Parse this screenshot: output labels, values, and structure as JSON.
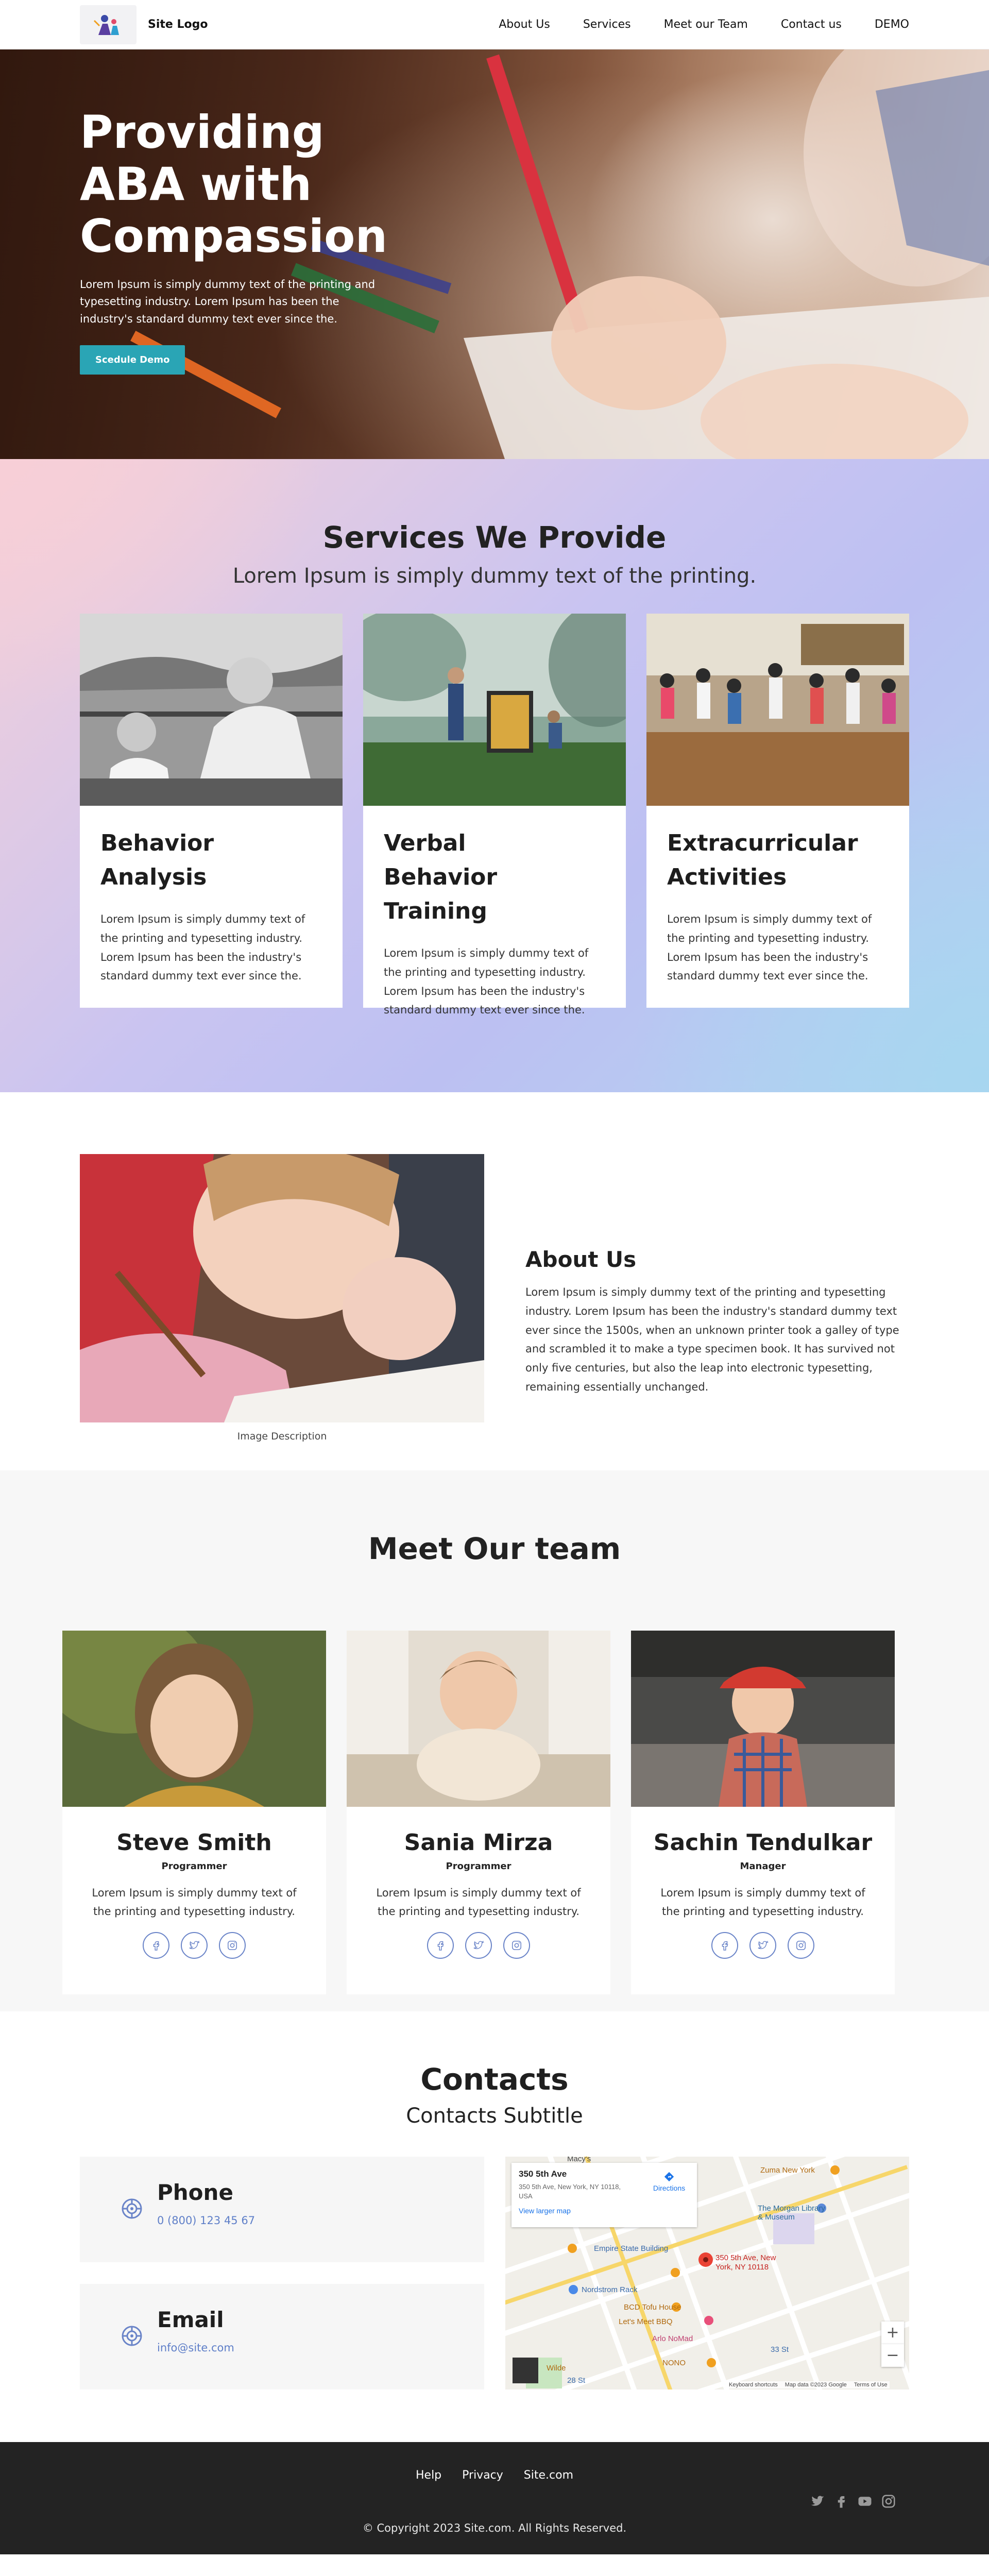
{
  "header": {
    "logo_text": "Site Logo",
    "nav": [
      "About Us",
      "Services",
      "Meet our Team",
      "Contact us",
      "DEMO"
    ]
  },
  "hero": {
    "title": "Providing ABA with Compassion",
    "text": "Lorem Ipsum is simply dummy text of the printing and typesetting industry. Lorem Ipsum has been the industry's standard dummy text ever since the.",
    "button": "Scedule Demo"
  },
  "services": {
    "title": "Services We Provide",
    "subtitle": "Lorem Ipsum is simply dummy text of the printing.",
    "cards": [
      {
        "title": "Behavior Analysis",
        "text": "Lorem Ipsum is simply dummy text of the printing and typesetting industry. Lorem Ipsum has been the industry's standard dummy text ever since the."
      },
      {
        "title": "Verbal Behavior Training",
        "text": "Lorem Ipsum is simply dummy text of the printing and typesetting industry. Lorem Ipsum has been the industry's standard dummy text ever since the."
      },
      {
        "title": "Extracurricular Activities",
        "text": "Lorem Ipsum is simply dummy text of the printing and typesetting industry. Lorem Ipsum has been the industry's standard dummy text ever since the."
      }
    ]
  },
  "about": {
    "caption": "Image Description",
    "title": "About Us",
    "text": "Lorem Ipsum is simply dummy text of the printing and typesetting industry. Lorem Ipsum has been the industry's standard dummy text ever since the 1500s, when an unknown printer took a galley of type and scrambled it to make a type specimen book. It has survived not only five centuries, but also the leap into electronic typesetting, remaining essentially unchanged."
  },
  "team": {
    "title": "Meet Our team",
    "members": [
      {
        "name": "Steve Smith",
        "role": "Programmer",
        "text": "Lorem Ipsum is simply dummy text of the printing and typesetting industry."
      },
      {
        "name": "Sania Mirza",
        "role": "Programmer",
        "text": "Lorem Ipsum is simply dummy text of the printing and typesetting industry."
      },
      {
        "name": "Sachin Tendulkar",
        "role": "Manager",
        "text": "Lorem Ipsum is simply dummy text of the printing and typesetting industry."
      }
    ],
    "social_icons": [
      "facebook-icon",
      "twitter-icon",
      "instagram-icon"
    ]
  },
  "contacts": {
    "title": "Contacts",
    "subtitle": "Contacts Subtitle",
    "phone_label": "Phone",
    "phone_value": "0 (800) 123 45 67",
    "email_label": "Email",
    "email_value": "info@site.com",
    "map": {
      "address": "350 5th Ave",
      "full_address": "350 5th Ave, New York, NY 10118, USA",
      "directions": "Directions",
      "larger_map": "View larger map",
      "pin_label": "350 5th Ave, New York, NY 10118",
      "places": [
        "Macy's",
        "Zuma New York",
        "The Morgan Library & Museum",
        "Empire State Building",
        "Nordstrom Rack",
        "BCD Tofu House",
        "Let's Meet BBQ",
        "Arlo NoMad",
        "NONO",
        "28 St",
        "33 St",
        "Wilde"
      ],
      "footer": [
        "Keyboard shortcuts",
        "Map data ©2023 Google",
        "Terms of Use"
      ]
    }
  },
  "footer": {
    "links": [
      "Help",
      "Privacy",
      "Site.com"
    ],
    "copyright": "© Copyright 2023 Site.com. All Rights Reserved.",
    "social_icons": [
      "twitter-icon",
      "facebook-icon",
      "youtube-icon",
      "instagram-icon"
    ]
  },
  "colors": {
    "accent": "#2aa5b5",
    "link": "#5f7fc8",
    "footer_bg": "#232323"
  }
}
